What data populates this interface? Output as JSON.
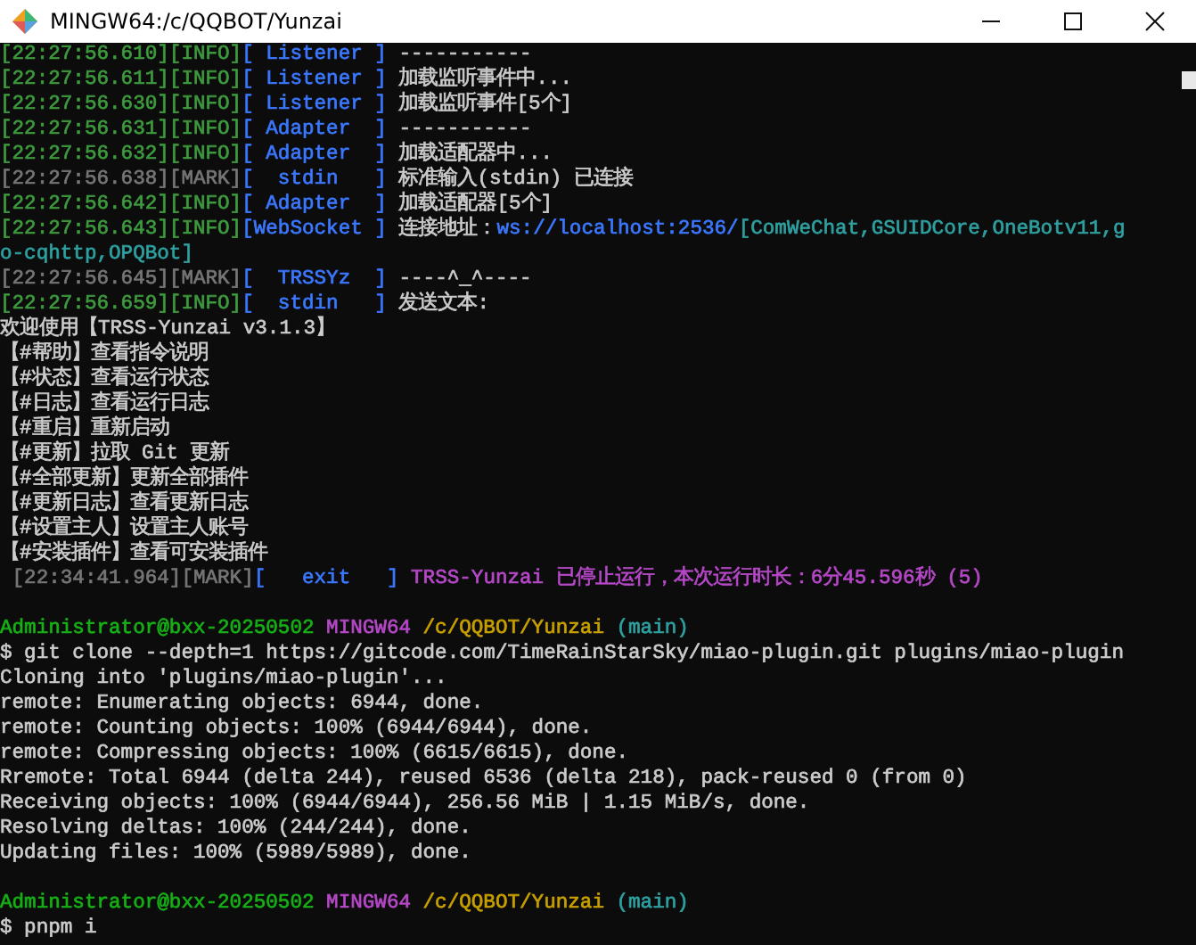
{
  "window": {
    "title": "MINGW64:/c/QQBOT/Yunzai"
  },
  "lines": [
    {
      "kind": "text",
      "segments": [
        {
          "text": "[22:27:56.610][INFO]",
          "color": "#3e9a3e"
        },
        {
          "text": "[ Listener ]",
          "color": "#3b78ff"
        },
        {
          "text": " -----------",
          "color": "#cccccc"
        }
      ]
    },
    {
      "kind": "text",
      "segments": [
        {
          "text": "[22:27:56.611][INFO]",
          "color": "#3e9a3e"
        },
        {
          "text": "[ Listener ]",
          "color": "#3b78ff"
        },
        {
          "text": " 加载监听事件中...",
          "color": "#cccccc"
        }
      ]
    },
    {
      "kind": "text",
      "segments": [
        {
          "text": "[22:27:56.630][INFO]",
          "color": "#3e9a3e"
        },
        {
          "text": "[ Listener ]",
          "color": "#3b78ff"
        },
        {
          "text": " 加载监听事件[5个]",
          "color": "#cccccc"
        }
      ]
    },
    {
      "kind": "text",
      "segments": [
        {
          "text": "[22:27:56.631][INFO]",
          "color": "#3e9a3e"
        },
        {
          "text": "[ Adapter  ]",
          "color": "#3b78ff"
        },
        {
          "text": " -----------",
          "color": "#cccccc"
        }
      ]
    },
    {
      "kind": "text",
      "segments": [
        {
          "text": "[22:27:56.632][INFO]",
          "color": "#3e9a3e"
        },
        {
          "text": "[ Adapter  ]",
          "color": "#3b78ff"
        },
        {
          "text": " 加载适配器中...",
          "color": "#cccccc"
        }
      ]
    },
    {
      "kind": "text",
      "segments": [
        {
          "text": "[22:27:56.638][MARK]",
          "color": "#767676"
        },
        {
          "text": "[  stdin   ]",
          "color": "#3b78ff"
        },
        {
          "text": " 标准输入(stdin) 已连接",
          "color": "#cccccc"
        }
      ]
    },
    {
      "kind": "text",
      "segments": [
        {
          "text": "[22:27:56.642][INFO]",
          "color": "#3e9a3e"
        },
        {
          "text": "[ Adapter  ]",
          "color": "#3b78ff"
        },
        {
          "text": " 加载适配器[5个]",
          "color": "#cccccc"
        }
      ]
    },
    {
      "kind": "text",
      "segments": [
        {
          "text": "[22:27:56.643][INFO]",
          "color": "#3e9a3e"
        },
        {
          "text": "[WebSocket ]",
          "color": "#3b78ff"
        },
        {
          "text": " 连接地址：",
          "color": "#cccccc"
        },
        {
          "text": "ws://localhost:2536/",
          "color": "#3b78ff"
        },
        {
          "text": "[ComWeChat,GSUIDCore,OneBotv11,g",
          "color": "#2fa0a0"
        }
      ]
    },
    {
      "kind": "text",
      "segments": [
        {
          "text": "o-cqhttp,OPQBot]",
          "color": "#2fa0a0"
        }
      ]
    },
    {
      "kind": "text",
      "segments": [
        {
          "text": "[22:27:56.645][MARK]",
          "color": "#767676"
        },
        {
          "text": "[  TRSSYz  ]",
          "color": "#3b78ff"
        },
        {
          "text": " ----^_^----",
          "color": "#cccccc"
        }
      ]
    },
    {
      "kind": "text",
      "segments": [
        {
          "text": "[22:27:56.659][INFO]",
          "color": "#3e9a3e"
        },
        {
          "text": "[  stdin   ]",
          "color": "#3b78ff"
        },
        {
          "text": " 发送文本:",
          "color": "#cccccc"
        }
      ]
    },
    {
      "kind": "text",
      "segments": [
        {
          "text": "欢迎使用【TRSS-Yunzai v3.1.3】",
          "color": "#cccccc"
        }
      ]
    },
    {
      "kind": "text",
      "segments": [
        {
          "text": "【#帮助】查看指令说明",
          "color": "#cccccc"
        }
      ]
    },
    {
      "kind": "text",
      "segments": [
        {
          "text": "【#状态】查看运行状态",
          "color": "#cccccc"
        }
      ]
    },
    {
      "kind": "text",
      "segments": [
        {
          "text": "【#日志】查看运行日志",
          "color": "#cccccc"
        }
      ]
    },
    {
      "kind": "text",
      "segments": [
        {
          "text": "【#重启】重新启动",
          "color": "#cccccc"
        }
      ]
    },
    {
      "kind": "text",
      "segments": [
        {
          "text": "【#更新】拉取 Git 更新",
          "color": "#cccccc"
        }
      ]
    },
    {
      "kind": "text",
      "segments": [
        {
          "text": "【#全部更新】更新全部插件",
          "color": "#cccccc"
        }
      ]
    },
    {
      "kind": "text",
      "segments": [
        {
          "text": "【#更新日志】查看更新日志",
          "color": "#cccccc"
        }
      ]
    },
    {
      "kind": "text",
      "segments": [
        {
          "text": "【#设置主人】设置主人账号",
          "color": "#cccccc"
        }
      ]
    },
    {
      "kind": "text",
      "segments": [
        {
          "text": "【#安装插件】查看可安装插件",
          "color": "#cccccc"
        }
      ]
    },
    {
      "kind": "text",
      "segments": [
        {
          "text": " [22:34:41.964][MARK]",
          "color": "#767676"
        },
        {
          "text": "[   exit   ]",
          "color": "#3b78ff"
        },
        {
          "text": " TRSS-Yunzai 已停止运行，本次运行时长：6分45.596秒 (5)",
          "color": "#b648c8"
        }
      ]
    },
    {
      "kind": "blank"
    },
    {
      "kind": "text",
      "segments": [
        {
          "text": "Administrator@bxx-20250502",
          "color": "#16b016"
        },
        {
          "text": " MINGW64",
          "color": "#b648c8"
        },
        {
          "text": " /c/QQBOT/Yunzai",
          "color": "#c8a000"
        },
        {
          "text": " (main)",
          "color": "#2fa0a0"
        }
      ]
    },
    {
      "kind": "text",
      "segments": [
        {
          "text": "$ git clone --depth=1 https://gitcode.com/TimeRainStarSky/miao-plugin.git plugins/miao-plugin",
          "color": "#cccccc"
        }
      ]
    },
    {
      "kind": "text",
      "segments": [
        {
          "text": "Cloning into 'plugins/miao-plugin'...",
          "color": "#cccccc"
        }
      ]
    },
    {
      "kind": "text",
      "segments": [
        {
          "text": "remote: Enumerating objects: 6944, done.",
          "color": "#cccccc"
        }
      ]
    },
    {
      "kind": "text",
      "segments": [
        {
          "text": "remote: Counting objects: 100% (6944/6944), done.",
          "color": "#cccccc"
        }
      ]
    },
    {
      "kind": "text",
      "segments": [
        {
          "text": "remote: Compressing objects: 100% (6615/6615), done.",
          "color": "#cccccc"
        }
      ]
    },
    {
      "kind": "text",
      "segments": [
        {
          "text": "Rremote: Total 6944 (delta 244), reused 6536 (delta 218), pack-reused 0 (from 0)",
          "color": "#cccccc"
        }
      ]
    },
    {
      "kind": "text",
      "segments": [
        {
          "text": "Receiving objects: 100% (6944/6944), 256.56 MiB | 1.15 MiB/s, done.",
          "color": "#cccccc"
        }
      ]
    },
    {
      "kind": "text",
      "segments": [
        {
          "text": "Resolving deltas: 100% (244/244), done.",
          "color": "#cccccc"
        }
      ]
    },
    {
      "kind": "text",
      "segments": [
        {
          "text": "Updating files: 100% (5989/5989), done.",
          "color": "#cccccc"
        }
      ]
    },
    {
      "kind": "blank"
    },
    {
      "kind": "text",
      "segments": [
        {
          "text": "Administrator@bxx-20250502",
          "color": "#16b016"
        },
        {
          "text": " MINGW64",
          "color": "#b648c8"
        },
        {
          "text": " /c/QQBOT/Yunzai",
          "color": "#c8a000"
        },
        {
          "text": " (main)",
          "color": "#2fa0a0"
        }
      ]
    },
    {
      "kind": "text",
      "segments": [
        {
          "text": "$ pnpm i",
          "color": "#cccccc"
        }
      ]
    }
  ]
}
